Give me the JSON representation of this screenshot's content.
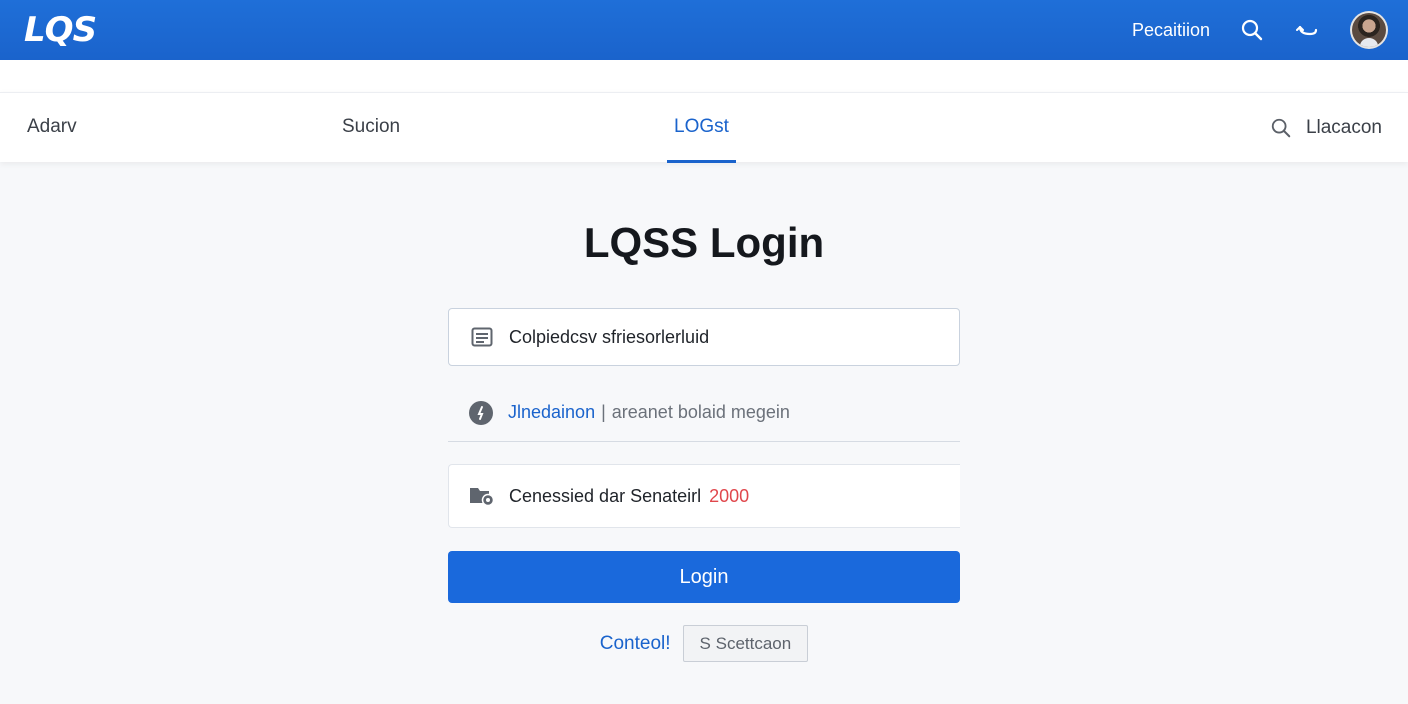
{
  "header": {
    "logo": "LQS",
    "link": "Pecaitiion",
    "icons": [
      "search-icon",
      "back-arrow-icon",
      "avatar"
    ],
    "brand_color": "#1a63cc"
  },
  "nav": {
    "items": [
      {
        "label": "Adarv",
        "active": false
      },
      {
        "label": "Sucion",
        "active": false
      },
      {
        "label": "LOGst",
        "active": true
      }
    ],
    "search_label": "Llacacon"
  },
  "login": {
    "title": "LQSS Login",
    "field1": {
      "icon": "document-icon",
      "value": "Colpiedcsv sfriesorlerluid"
    },
    "field2": {
      "icon": "info-icon",
      "link": "Jlnedainon",
      "separator": "|",
      "text": "areanet bolaid megein"
    },
    "field3": {
      "icon": "folder-settings-icon",
      "text": "Cenessied dar Senateirl",
      "highlight": "2000"
    },
    "submit_label": "Login",
    "cancel_label": "Conteol!",
    "secondary_label": "S Scettcaon"
  }
}
